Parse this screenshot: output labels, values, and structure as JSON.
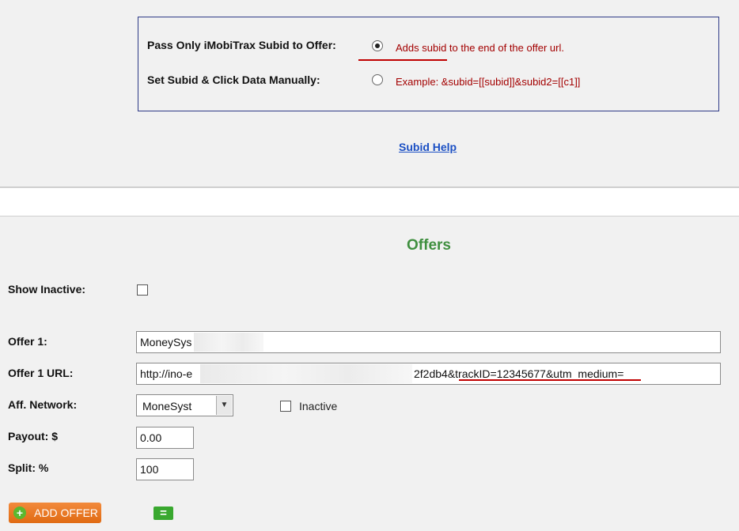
{
  "subid": {
    "pass_only_label": "Pass Only iMobiTrax Subid to Offer:",
    "pass_only_desc": "Adds subid to the end of the offer url.",
    "pass_only_selected": true,
    "manual_label": "Set Subid & Click Data Manually:",
    "manual_desc": "Example: &subid=[[subid]]&subid2=[[c1]]",
    "manual_selected": false,
    "help_link": "Subid Help"
  },
  "offers": {
    "title": "Offers",
    "show_inactive_label": "Show Inactive:",
    "show_inactive_checked": false,
    "offer_name_label": "Offer 1:",
    "offer_name_value": "MoneySys",
    "offer_url_label": "Offer 1 URL:",
    "offer_url_prefix": "http://ino-e",
    "offer_url_suffix": "2f2db4&trackID=12345677&utm_medium=",
    "aff_network_label": "Aff. Network:",
    "aff_network_value": "MoneSyst",
    "inactive_label": "Inactive",
    "inactive_checked": false,
    "payout_label": "Payout: $",
    "payout_value": "0.00",
    "split_label": "Split: %",
    "split_value": "100",
    "add_offer_label": "ADD OFFER",
    "add_offer_icon": "plus-circle-icon",
    "extra_icon": "equals-icon",
    "extra_icon_glyph": "="
  },
  "colors": {
    "accent_green": "#3f8f3f",
    "link_blue": "#1a4fc4",
    "desc_red": "#a30000",
    "button_orange": "#e06a12"
  }
}
